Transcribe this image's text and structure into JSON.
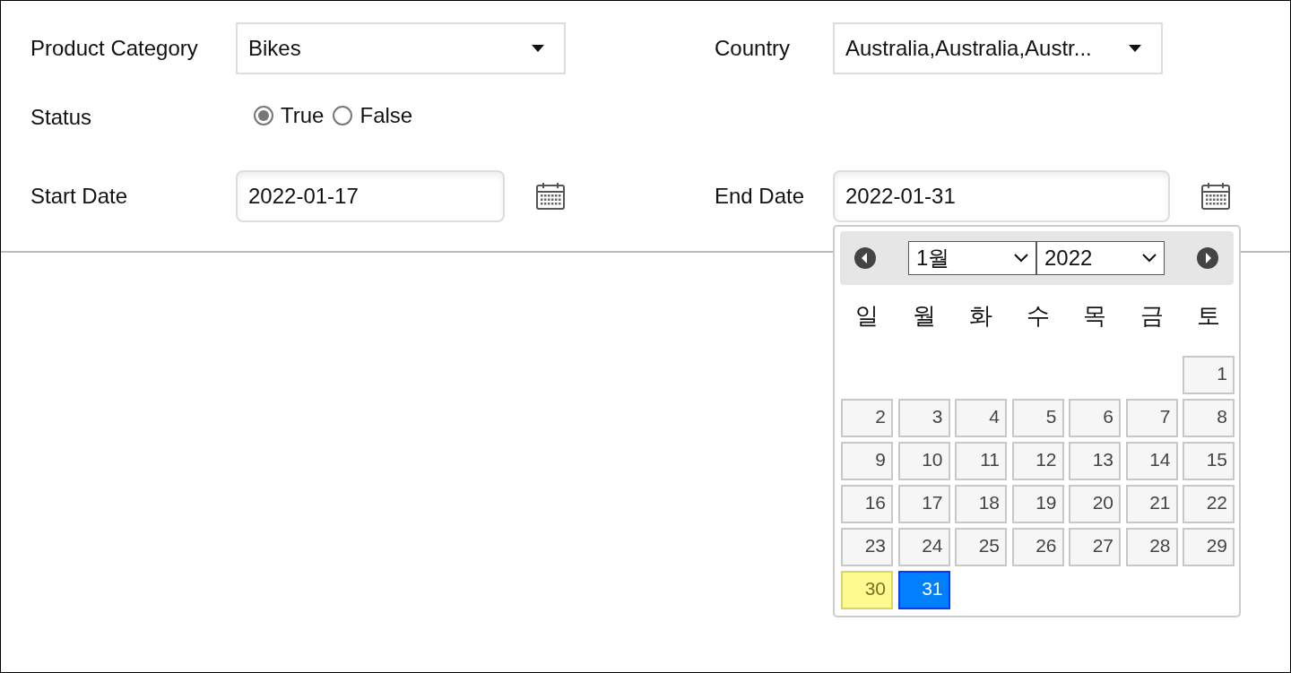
{
  "filters": {
    "product_category": {
      "label": "Product Category",
      "value": "Bikes"
    },
    "country": {
      "label": "Country",
      "value": "Australia,Australia,Austr..."
    },
    "status": {
      "label": "Status",
      "options": [
        {
          "label": "True",
          "selected": true
        },
        {
          "label": "False",
          "selected": false
        }
      ]
    },
    "start_date": {
      "label": "Start Date",
      "value": "2022-01-17"
    },
    "end_date": {
      "label": "End Date",
      "value": "2022-01-31"
    }
  },
  "datepicker": {
    "open": true,
    "month": "1월",
    "year": "2022",
    "weekdays": [
      "일",
      "월",
      "화",
      "수",
      "목",
      "금",
      "토"
    ],
    "weeks": [
      [
        {
          "kind": "blank"
        },
        {
          "kind": "blank"
        },
        {
          "kind": "blank"
        },
        {
          "kind": "blank"
        },
        {
          "kind": "blank"
        },
        {
          "kind": "blank"
        },
        {
          "kind": "day",
          "label": "1",
          "today": false,
          "selected": false
        }
      ],
      [
        {
          "kind": "day",
          "label": "2",
          "today": false,
          "selected": false
        },
        {
          "kind": "day",
          "label": "3",
          "today": false,
          "selected": false
        },
        {
          "kind": "day",
          "label": "4",
          "today": false,
          "selected": false
        },
        {
          "kind": "day",
          "label": "5",
          "today": false,
          "selected": false
        },
        {
          "kind": "day",
          "label": "6",
          "today": false,
          "selected": false
        },
        {
          "kind": "day",
          "label": "7",
          "today": false,
          "selected": false
        },
        {
          "kind": "day",
          "label": "8",
          "today": false,
          "selected": false
        }
      ],
      [
        {
          "kind": "day",
          "label": "9",
          "today": false,
          "selected": false
        },
        {
          "kind": "day",
          "label": "10",
          "today": false,
          "selected": false
        },
        {
          "kind": "day",
          "label": "11",
          "today": false,
          "selected": false
        },
        {
          "kind": "day",
          "label": "12",
          "today": false,
          "selected": false
        },
        {
          "kind": "day",
          "label": "13",
          "today": false,
          "selected": false
        },
        {
          "kind": "day",
          "label": "14",
          "today": false,
          "selected": false
        },
        {
          "kind": "day",
          "label": "15",
          "today": false,
          "selected": false
        }
      ],
      [
        {
          "kind": "day",
          "label": "16",
          "today": false,
          "selected": false
        },
        {
          "kind": "day",
          "label": "17",
          "today": false,
          "selected": false
        },
        {
          "kind": "day",
          "label": "18",
          "today": false,
          "selected": false
        },
        {
          "kind": "day",
          "label": "19",
          "today": false,
          "selected": false
        },
        {
          "kind": "day",
          "label": "20",
          "today": false,
          "selected": false
        },
        {
          "kind": "day",
          "label": "21",
          "today": false,
          "selected": false
        },
        {
          "kind": "day",
          "label": "22",
          "today": false,
          "selected": false
        }
      ],
      [
        {
          "kind": "day",
          "label": "23",
          "today": false,
          "selected": false
        },
        {
          "kind": "day",
          "label": "24",
          "today": false,
          "selected": false
        },
        {
          "kind": "day",
          "label": "25",
          "today": false,
          "selected": false
        },
        {
          "kind": "day",
          "label": "26",
          "today": false,
          "selected": false
        },
        {
          "kind": "day",
          "label": "27",
          "today": false,
          "selected": false
        },
        {
          "kind": "day",
          "label": "28",
          "today": false,
          "selected": false
        },
        {
          "kind": "day",
          "label": "29",
          "today": false,
          "selected": false
        }
      ],
      [
        {
          "kind": "day",
          "label": "30",
          "today": true,
          "selected": false
        },
        {
          "kind": "day",
          "label": "31",
          "today": false,
          "selected": true
        },
        {
          "kind": "blank"
        },
        {
          "kind": "blank"
        },
        {
          "kind": "blank"
        },
        {
          "kind": "blank"
        },
        {
          "kind": "blank"
        }
      ]
    ]
  }
}
